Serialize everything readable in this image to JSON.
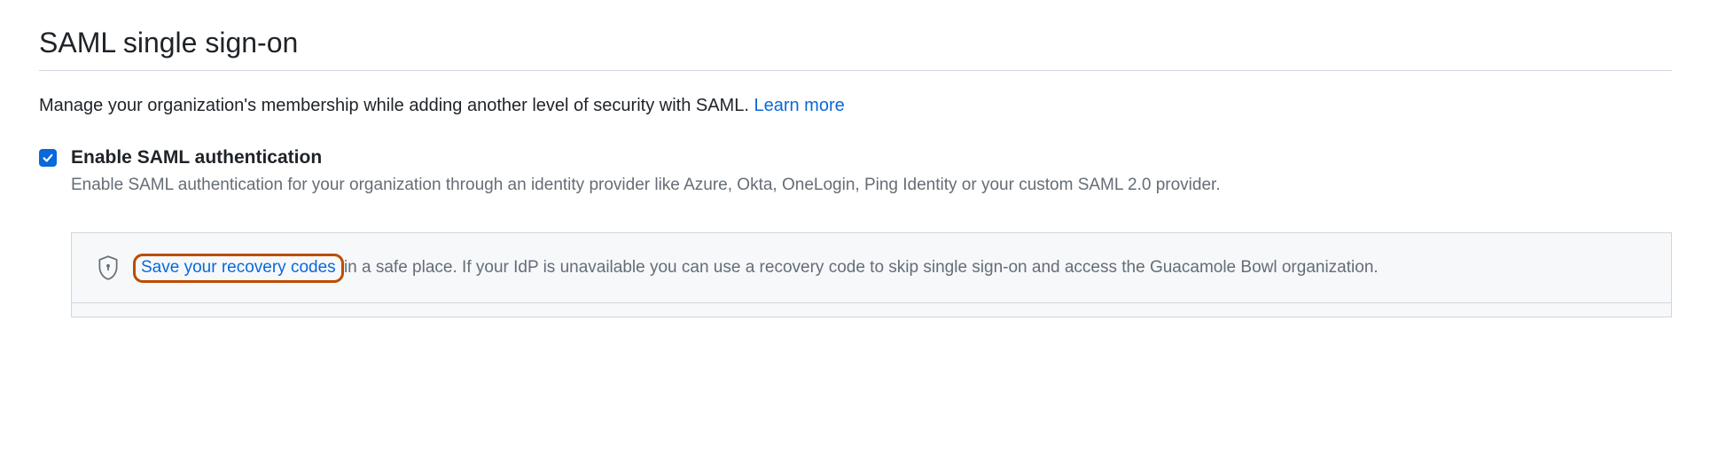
{
  "section": {
    "heading": "SAML single sign-on",
    "intro_text": "Manage your organization's membership while adding another level of security with SAML. ",
    "learn_more_label": "Learn more"
  },
  "checkbox": {
    "checked": true,
    "label": "Enable SAML authentication",
    "description": "Enable SAML authentication for your organization through an identity provider like Azure, Okta, OneLogin, Ping Identity or your custom SAML 2.0 provider."
  },
  "recovery_panel": {
    "link_label": "Save your recovery codes",
    "remainder_text": " in a safe place. If your IdP is unavailable you can use a recovery code to skip single sign-on and access the Guacamole Bowl organization."
  }
}
